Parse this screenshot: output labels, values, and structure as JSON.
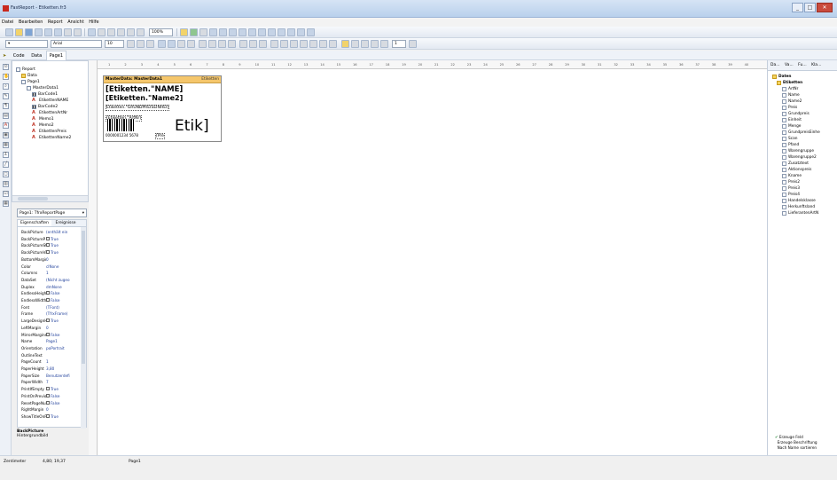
{
  "window": {
    "title": "FastReport - Etiketten.fr3"
  },
  "menu": [
    "Datei",
    "Bearbeiten",
    "Report",
    "Ansicht",
    "Hilfe"
  ],
  "toolbar": {
    "zoom": "100%",
    "font_name": "Arial",
    "font_size": "10",
    "style_combo": "1"
  },
  "tabs": [
    "Code",
    "Data",
    "Page1"
  ],
  "tree": [
    {
      "label": "Report",
      "icon": "report-icon",
      "indent": 0
    },
    {
      "label": "Data",
      "icon": "folder-icon",
      "indent": 1
    },
    {
      "label": "Page1",
      "icon": "page-icon",
      "indent": 1
    },
    {
      "label": "MasterData1",
      "icon": "band-icon",
      "indent": 2
    },
    {
      "label": "BarCode1",
      "icon": "barcode-icon",
      "indent": 3
    },
    {
      "label": "EtikettenNAME",
      "icon": "text-icon",
      "indent": 3
    },
    {
      "label": "BarCode2",
      "icon": "barcode-icon",
      "indent": 3
    },
    {
      "label": "EtikettenArtNr",
      "icon": "text-icon",
      "indent": 3
    },
    {
      "label": "Memo1",
      "icon": "text-icon",
      "indent": 3
    },
    {
      "label": "Memo2",
      "icon": "text-icon",
      "indent": 3
    },
    {
      "label": "EtikettenPreis",
      "icon": "text-icon",
      "indent": 3
    },
    {
      "label": "EtikettenName2",
      "icon": "text-icon",
      "indent": 3
    }
  ],
  "page_selector": "Page1: TfrxReportPage",
  "prop_tabs": [
    "Eigenschaften",
    "Ereignisse"
  ],
  "properties": [
    {
      "key": "BackPicture",
      "value": "(enthält ein",
      "check": false
    },
    {
      "key": "BackPictureP",
      "value": "True",
      "check": true
    },
    {
      "key": "BackPictureSt",
      "value": "True",
      "check": true
    },
    {
      "key": "BackPictureVi",
      "value": "True",
      "check": true
    },
    {
      "key": "BottomMargin",
      "value": "0",
      "check": false
    },
    {
      "key": "Color",
      "value": "clNone",
      "check": false
    },
    {
      "key": "Columns",
      "value": "1",
      "check": false
    },
    {
      "key": "DataSet",
      "value": "(Nicht zugeo",
      "check": false
    },
    {
      "key": "Duplex",
      "value": "dmNone",
      "check": false
    },
    {
      "key": "EndlessHeigh",
      "value": "False",
      "check": true
    },
    {
      "key": "EndlessWidth",
      "value": "False",
      "check": true
    },
    {
      "key": "Font",
      "value": "(TFont)",
      "check": false
    },
    {
      "key": "Frame",
      "value": "(TfrxFrame)",
      "check": false
    },
    {
      "key": "LargeDesignH",
      "value": "True",
      "check": true
    },
    {
      "key": "LeftMargin",
      "value": "0",
      "check": false
    },
    {
      "key": "MirrorMargins",
      "value": "False",
      "check": true
    },
    {
      "key": "Name",
      "value": "Page1",
      "check": false
    },
    {
      "key": "Orientation",
      "value": "poPortrait",
      "check": false
    },
    {
      "key": "OutlineText",
      "value": "",
      "check": false
    },
    {
      "key": "PageCount",
      "value": "1",
      "check": false
    },
    {
      "key": "PaperHeight",
      "value": "3,80",
      "check": false
    },
    {
      "key": "PaperSize",
      "value": "Benutzerdefi",
      "check": false
    },
    {
      "key": "PaperWidth",
      "value": "7",
      "check": false
    },
    {
      "key": "PrintIfEmpty",
      "value": "True",
      "check": true
    },
    {
      "key": "PrintOnPrevio",
      "value": "False",
      "check": true
    },
    {
      "key": "ResetPageNu",
      "value": "False",
      "check": true
    },
    {
      "key": "RightMargin",
      "value": "0",
      "check": false
    },
    {
      "key": "ShowTitleOnP",
      "value": "True",
      "check": true
    }
  ],
  "prop_desc": {
    "title": "BackPicture",
    "text": "Hintergrundbild"
  },
  "ruler_ticks": [
    "1",
    "2",
    "3",
    "4",
    "5",
    "6",
    "7",
    "8",
    "9",
    "10",
    "11",
    "12",
    "13",
    "14",
    "15",
    "16",
    "17",
    "18",
    "19",
    "20",
    "21",
    "22",
    "23",
    "24",
    "25",
    "26",
    "27",
    "28",
    "29",
    "30",
    "31",
    "32",
    "33",
    "34",
    "35",
    "36",
    "37",
    "38",
    "39",
    "40"
  ],
  "band": {
    "title": "MasterData: MasterData1",
    "tag": "Etiketten"
  },
  "fields": {
    "name": "[Etiketten.\"NAME]",
    "name2": "[Etiketten.\"Name2]",
    "unit": "Etiketten.\"GRUNDPREISEINHEI]",
    "artnr": "[Etiketten.\"ArtNr]",
    "barcode_text": "0000001234 5678",
    "preis": "[Pre",
    "etik": "Etik]"
  },
  "right_tabs": [
    "Da...",
    "Va...",
    "Fu...",
    "Kla..."
  ],
  "data_tree": {
    "root": "Daten",
    "dataset": "Etiketten",
    "fields": [
      "ArtNr",
      "Name",
      "Name2",
      "Preis",
      "Grundpreis",
      "Einheit",
      "Menge",
      "GrundpreisEinhe",
      "Scan",
      "Pfand",
      "Warengruppe",
      "Warengruppe2",
      "Zusatztext",
      "Aktionspreis",
      "Kname",
      "Preis2",
      "Preis3",
      "Preis4",
      "Handelsklasse",
      "Herkunftsland",
      "LieferantenArtN"
    ]
  },
  "right_footer": [
    "Erzeuge Feld",
    "Erzeuge Beschriftung",
    "Nach Name sortieren"
  ],
  "status": {
    "unit": "Zentimeter",
    "coords": "4,80; 19,37",
    "page": "Page1"
  }
}
